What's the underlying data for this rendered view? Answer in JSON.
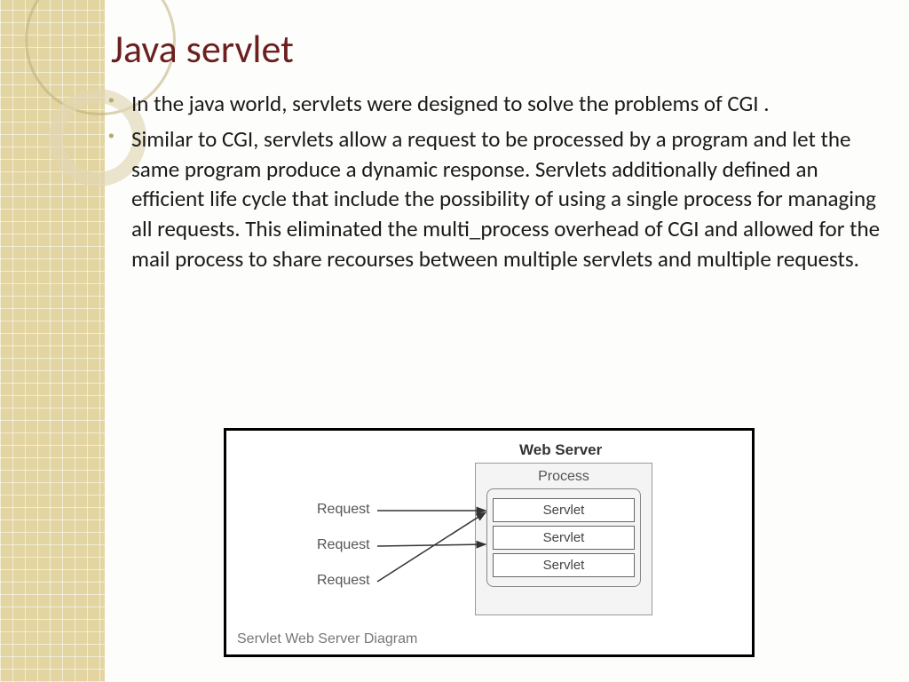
{
  "title": "Java servlet",
  "bullets": [
    "In the java world, servlets were designed to solve the problems of CGI .",
    "Similar to CGI, servlets allow a request to be processed by a program and let the same program produce a dynamic response. Servlets additionally defined an efficient life cycle that include the possibility of using a single process for managing all requests. This eliminated the multi_process overhead of CGI and allowed for the mail process to share recourses between multiple servlets and multiple requests."
  ],
  "diagram": {
    "server_title": "Web Server",
    "process_label": "Process",
    "servlets": [
      "Servlet",
      "Servlet",
      "Servlet"
    ],
    "requests": [
      "Request",
      "Request",
      "Request"
    ],
    "caption": "Servlet Web Server Diagram"
  }
}
